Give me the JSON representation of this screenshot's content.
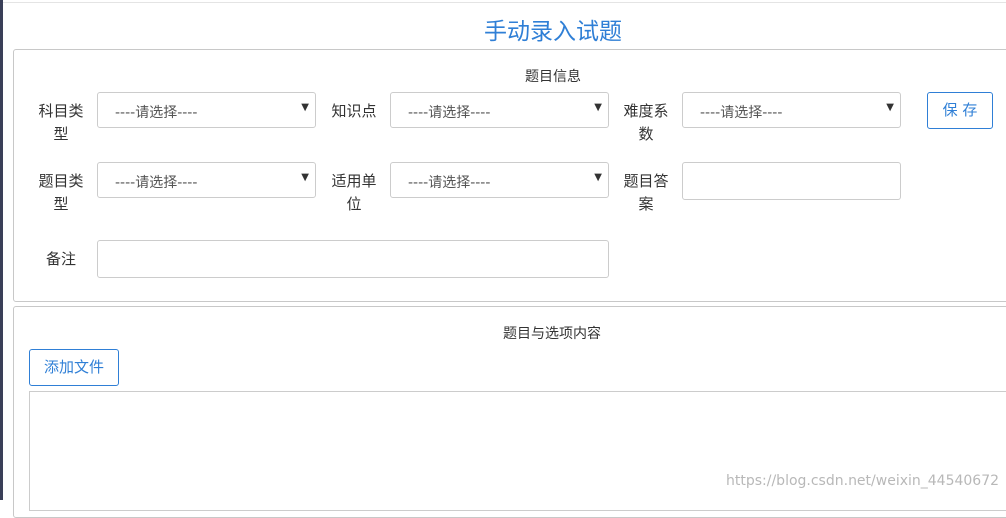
{
  "page": {
    "title": "手动录入试题"
  },
  "question_info": {
    "section_title": "题目信息",
    "subject_type": {
      "label_line1": "科目类",
      "label_line2": "型",
      "selected": "----请选择----"
    },
    "knowledge_point": {
      "label": "知识点",
      "selected": "----请选择----"
    },
    "difficulty": {
      "label_line1": "难度系",
      "label_line2": "数",
      "selected": "----请选择----"
    },
    "question_type": {
      "label_line1": "题目类",
      "label_line2": "型",
      "selected": "----请选择----"
    },
    "applicable_unit": {
      "label_line1": "适用单",
      "label_line2": "位",
      "selected": "----请选择----"
    },
    "answer": {
      "label_line1": "题目答",
      "label_line2": "案",
      "value": ""
    },
    "remark": {
      "label": "备注",
      "value": ""
    },
    "save_label": "保 存"
  },
  "content": {
    "section_title": "题目与选项内容",
    "add_file_label": "添加文件"
  },
  "watermark": "https://blog.csdn.net/weixin_44540672",
  "colors": {
    "accent": "#2f7fd6",
    "border": "#cccccc",
    "text": "#333333"
  }
}
